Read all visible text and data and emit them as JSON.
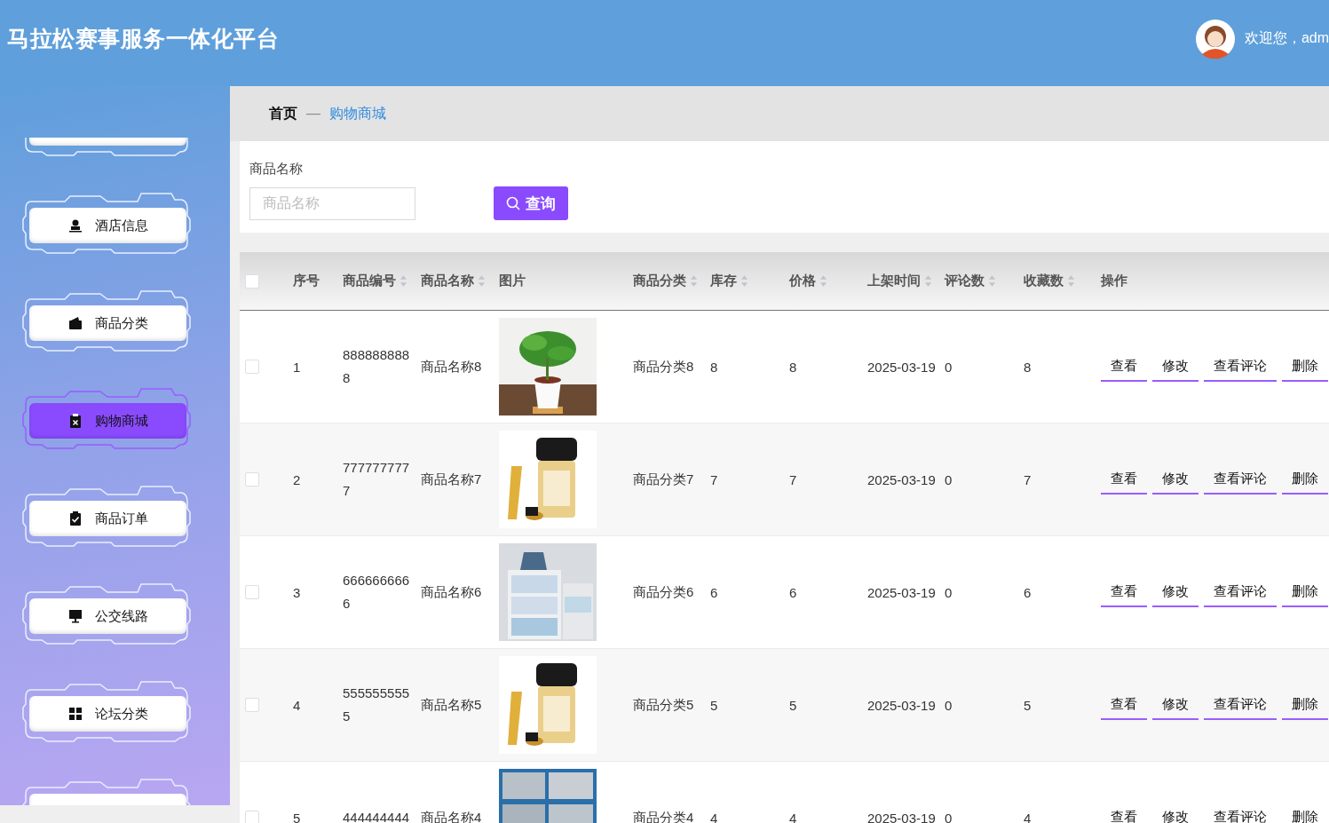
{
  "header": {
    "title": "马拉松赛事服务一体化平台",
    "welcome": "欢迎您，adm"
  },
  "sidebar": {
    "items": [
      {
        "label": "酒店信息",
        "selected": false
      },
      {
        "label": "商品分类",
        "selected": false
      },
      {
        "label": "购物商城",
        "selected": true
      },
      {
        "label": "商品订单",
        "selected": false
      },
      {
        "label": "公交线路",
        "selected": false
      },
      {
        "label": "论坛分类",
        "selected": false
      }
    ]
  },
  "breadcrumb": {
    "home": "首页",
    "separator": "—",
    "current": "购物商城"
  },
  "search": {
    "label": "商品名称",
    "placeholder": "商品名称",
    "button": "查询"
  },
  "table": {
    "header_checked": false,
    "columns": [
      {
        "label": "序号",
        "sortable": false
      },
      {
        "label": "商品编号",
        "sortable": true
      },
      {
        "label": "商品名称",
        "sortable": true
      },
      {
        "label": "图片",
        "sortable": false
      },
      {
        "label": "商品分类",
        "sortable": true
      },
      {
        "label": "库存",
        "sortable": true
      },
      {
        "label": "价格",
        "sortable": true
      },
      {
        "label": "上架时间",
        "sortable": true
      },
      {
        "label": "评论数",
        "sortable": true
      },
      {
        "label": "收藏数",
        "sortable": true
      },
      {
        "label": "操作",
        "sortable": false
      }
    ],
    "rows": [
      {
        "checked": false,
        "index": "1",
        "code": "8888888888",
        "name": "商品名称8",
        "image": {
          "kind": "picture"
        },
        "category": "商品分类8",
        "stock": "8",
        "price": "8",
        "date": "2025-03-19",
        "comments": "0",
        "favorites": "8",
        "actions": [
          "查看",
          "修改",
          "查看评论",
          "删除"
        ]
      },
      {
        "checked": false,
        "index": "2",
        "code": "7777777777",
        "name": "商品名称7",
        "image": {
          "kind": "picture"
        },
        "category": "商品分类7",
        "stock": "7",
        "price": "7",
        "date": "2025-03-19",
        "comments": "0",
        "favorites": "7",
        "actions": [
          "查看",
          "修改",
          "查看评论",
          "删除"
        ]
      },
      {
        "checked": false,
        "index": "3",
        "code": "6666666666",
        "name": "商品名称6",
        "image": {
          "kind": "picture"
        },
        "category": "商品分类6",
        "stock": "6",
        "price": "6",
        "date": "2025-03-19",
        "comments": "0",
        "favorites": "6",
        "actions": [
          "查看",
          "修改",
          "查看评论",
          "删除"
        ]
      },
      {
        "checked": false,
        "index": "4",
        "code": "5555555555",
        "name": "商品名称5",
        "image": {
          "kind": "picture"
        },
        "category": "商品分类5",
        "stock": "5",
        "price": "5",
        "date": "2025-03-19",
        "comments": "0",
        "favorites": "5",
        "actions": [
          "查看",
          "修改",
          "查看评论",
          "删除"
        ]
      },
      {
        "checked": false,
        "index": "5",
        "code": "444444444",
        "name": "商品名称4",
        "image": {
          "kind": "picture"
        },
        "category": "商品分类4",
        "stock": "4",
        "price": "4",
        "date": "2025-03-19",
        "comments": "0",
        "favorites": "4",
        "actions": [
          "查看",
          "修改",
          "查看评论",
          "删除"
        ]
      }
    ]
  }
}
